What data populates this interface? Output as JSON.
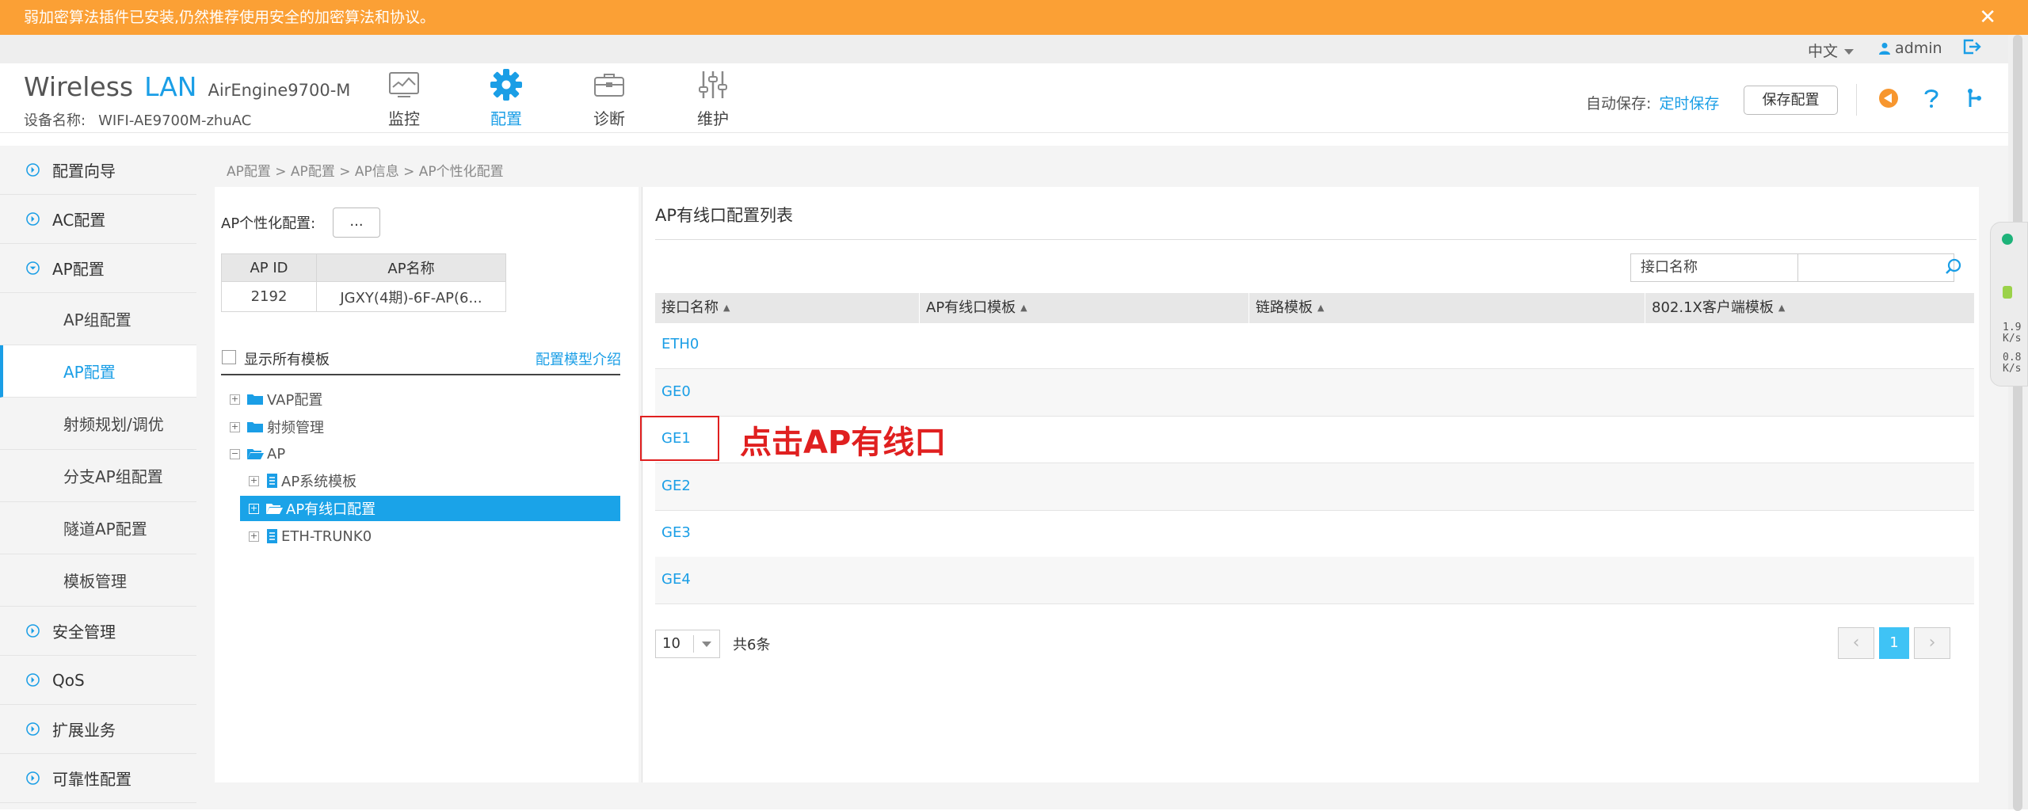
{
  "warning": {
    "text": "弱加密算法插件已安装,仍然推荐使用安全的加密算法和协议。",
    "close": "✕"
  },
  "userbar": {
    "language": "中文",
    "username": "admin"
  },
  "header": {
    "brand_main": "Wireless",
    "brand_lan": "LAN",
    "brand_model": "AirEngine9700-M",
    "device_label": "设备名称:",
    "device_name": "WIFI-AE9700M-zhuAC",
    "nav": [
      {
        "label": "监控",
        "icon": "monitor-icon"
      },
      {
        "label": "配置",
        "icon": "gear-icon",
        "active": true
      },
      {
        "label": "诊断",
        "icon": "toolbox-icon"
      },
      {
        "label": "维护",
        "icon": "sliders-icon"
      }
    ],
    "autosave_label": "自动保存:",
    "autosave_link": "定时保存",
    "save_button": "保存配置",
    "accent_color": "#1a9ee6",
    "warn_color": "#fba035"
  },
  "sidebar": {
    "items_top": [
      "配置向导",
      "AC配置",
      "AP配置"
    ],
    "sub_items": [
      "AP组配置",
      "AP配置",
      "射频规划/调优",
      "分支AP组配置",
      "隧道AP配置",
      "模板管理"
    ],
    "items_bottom": [
      "安全管理",
      "QoS",
      "扩展业务",
      "可靠性配置"
    ]
  },
  "breadcrumb": "AP配置 > AP配置 > AP信息 > AP个性化配置",
  "left": {
    "ap_config_label": "AP个性化配置:",
    "dot_button": "...",
    "table_headers": [
      "AP ID",
      "AP名称"
    ],
    "table_row": [
      "2192",
      "JGXY(4期)-6F-AP(6..."
    ],
    "show_all_templates": "显示所有模板",
    "model_intro_link": "配置模型介绍",
    "tree": [
      "VAP配置",
      "射频管理",
      "AP",
      "AP系统模板",
      "AP有线口配置",
      "ETH-TRUNK0"
    ]
  },
  "right": {
    "title": "AP有线口配置列表",
    "search_field": "接口名称",
    "search_value": "",
    "columns": [
      "接口名称",
      "AP有线口模板",
      "链路模板",
      "802.1X客户端模板"
    ],
    "rows": [
      "ETH0",
      "GE0",
      "GE1",
      "GE2",
      "GE3",
      "GE4"
    ],
    "annotation": "点击AP有线口",
    "page_size": "10",
    "total": "共6条",
    "current_page": "1"
  },
  "widget": {
    "up": "1.9",
    "down": "0.8",
    "unit": "K/s"
  }
}
